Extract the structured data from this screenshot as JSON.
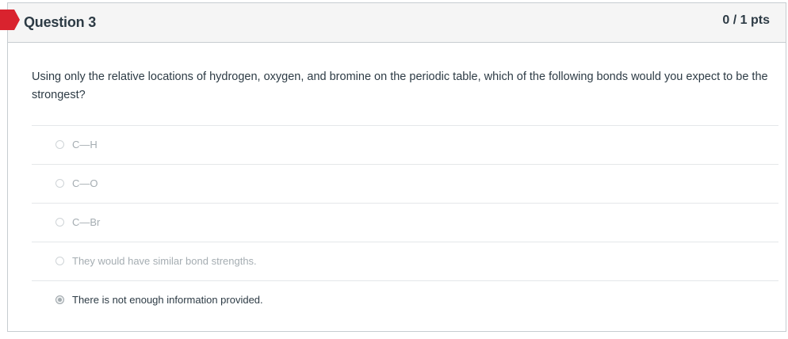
{
  "question": {
    "title": "Question 3",
    "points": "0 / 1 pts",
    "text": "Using only the relative locations of hydrogen, oxygen, and bromine on the periodic table, which of the following bonds would you expect to be the strongest?",
    "flag_color": "#d9232e"
  },
  "answers": [
    {
      "label": "C—H",
      "selected": false
    },
    {
      "label": "C—O",
      "selected": false
    },
    {
      "label": "C—Br",
      "selected": false
    },
    {
      "label": "They would have similar bond strengths.",
      "selected": false
    },
    {
      "label": "There is not enough information provided.",
      "selected": true
    }
  ]
}
